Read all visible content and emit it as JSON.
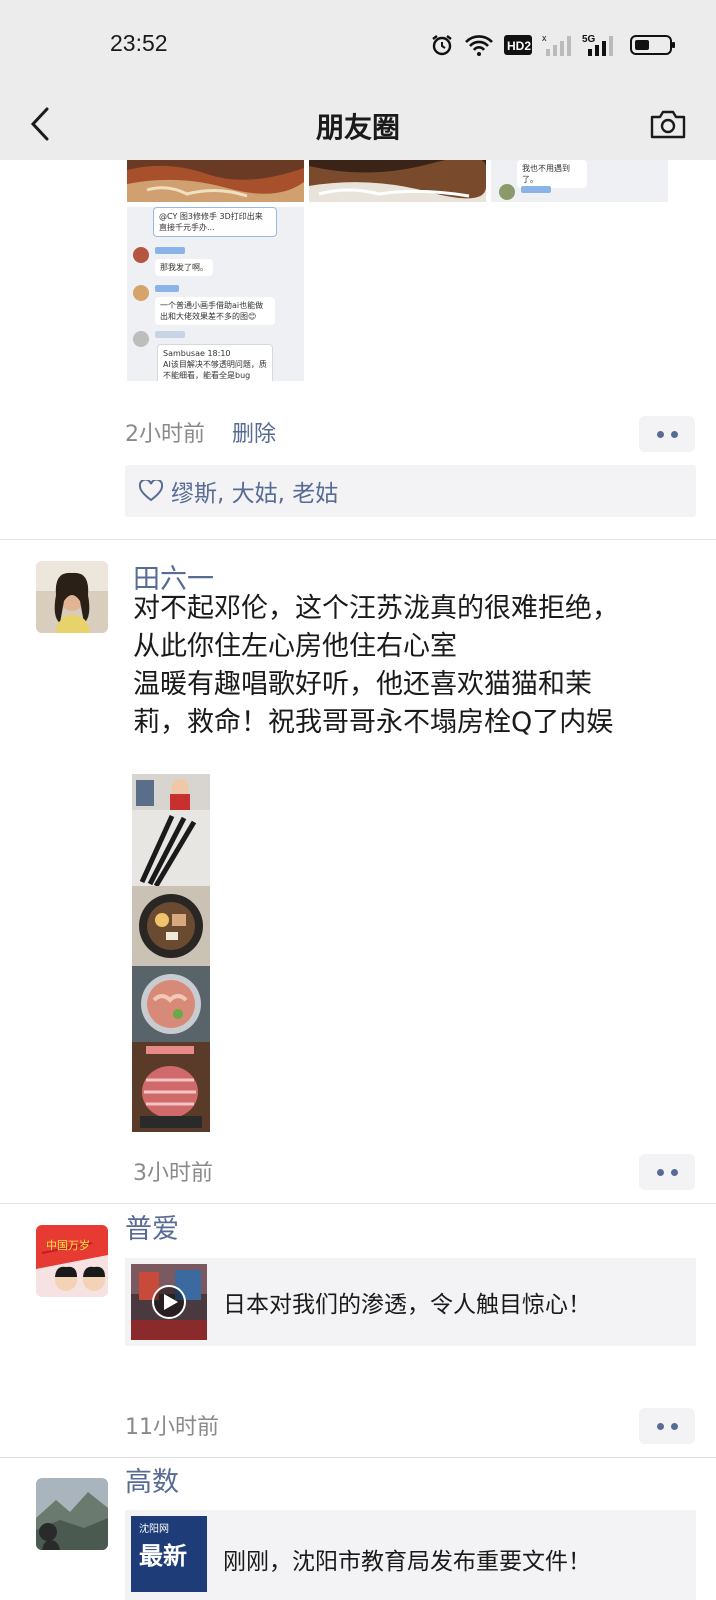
{
  "status_bar": {
    "time": "23:52",
    "icons": [
      "alarm-icon",
      "wifi-icon",
      "hd2-icon",
      "signal-icon",
      "5g-signal-icon",
      "battery-icon"
    ],
    "hd_label": "HD2",
    "fiveg_label": "5G"
  },
  "nav": {
    "title": "朋友圈",
    "back_icon": "chevron-left-icon",
    "camera_icon": "camera-icon"
  },
  "posts": [
    {
      "images_partial": true,
      "chat_lines": [
        "我也不用遇到了。",
        "@CY 图3修修手 3D打印出来 直接千元手办...",
        "那我发了啊。",
        "一个普通小画手借助ai也能做出和大佬效果差不多的图😊",
        "Sambusae 18:10",
        "AI该目解决不够透明问题，质不能细看，能看全是bug"
      ],
      "time": "2小时前",
      "delete": "删除",
      "likes": "缪斯, 大姑, 老姑"
    },
    {
      "user": "田六一",
      "text_lines": [
        "对不起邓伦，这个汪苏泷真的很难拒绝，",
        "从此你住左心房他住右心室",
        "温暖有趣唱歌好听，他还喜欢猫猫和茉",
        "莉，救命！祝我哥哥永不塌房栓Q了内娱"
      ],
      "time": "3小时前"
    },
    {
      "user": "普爱",
      "avatar_text": "中国万岁",
      "link_title": "日本对我们的渗透，令人触目惊心！",
      "time": "11小时前"
    },
    {
      "user": "高数",
      "link_thumb_text": "最新",
      "link_thumb_sub": "沈阳网",
      "link_title": "刚刚，沈阳市教育局发布重要文件！"
    }
  ],
  "colors": {
    "link_blue": "#576b95",
    "bar_bg": "#ececec",
    "card_bg": "#f3f3f5",
    "time_gray": "#8a8a8a"
  }
}
